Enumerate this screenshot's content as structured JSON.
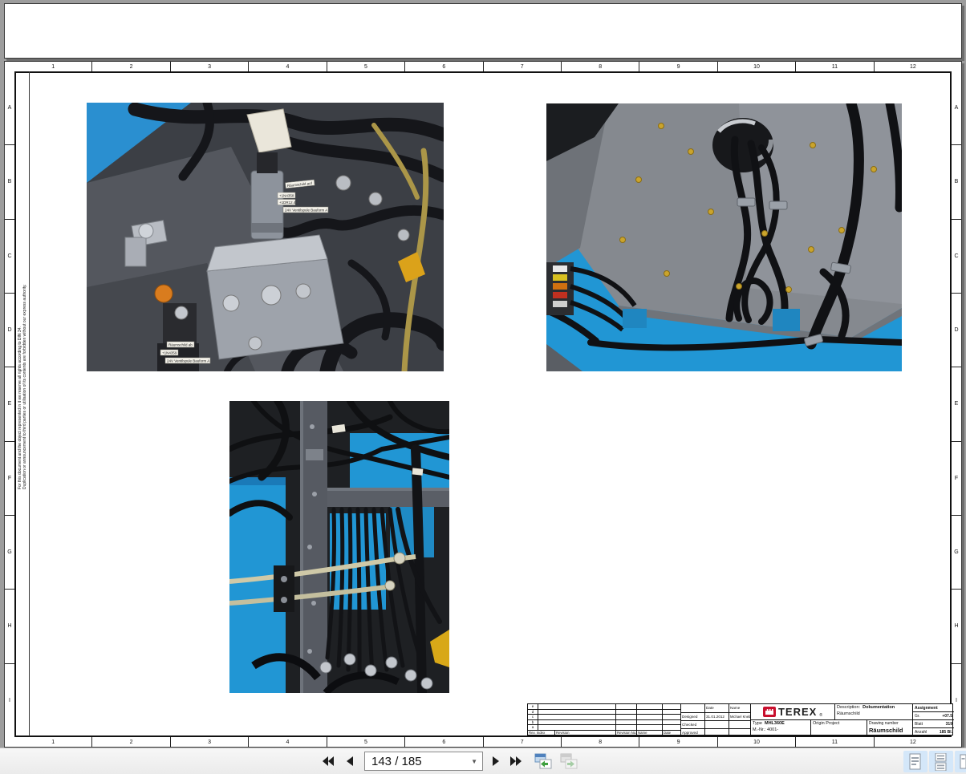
{
  "viewer": {
    "background_color": "#9d9d9d",
    "toolbar": {
      "page_field": "143 / 185",
      "icons": {
        "first_page": "double-left-triangle",
        "previous_page": "left-triangle",
        "next_page": "right-triangle",
        "last_page": "double-right-triangle",
        "dropdown": "▼",
        "previous_view": "window-green-arrow-left",
        "next_view": "window-green-arrow-right-disabled",
        "layout_single": "single-page-layout",
        "layout_continuous": "continuous-page-layout",
        "layout_facing": "facing-pages-layout"
      },
      "layout_highlight_color": "#d4e7f9"
    }
  },
  "sheet": {
    "rulers": {
      "columns": [
        "1",
        "2",
        "3",
        "4",
        "5",
        "6",
        "7",
        "8",
        "9",
        "10",
        "11",
        "12"
      ],
      "rows": [
        "A",
        "B",
        "C",
        "D",
        "E",
        "F",
        "G",
        "H",
        "I"
      ]
    },
    "copyright": {
      "line1": "For this document and the object represented in it we reserve all rights according to DIN 34.",
      "line2": "Duplication or announcement to third parties or utilisation of its contents are forbidden without our express authority."
    },
    "photos": {
      "valve_labels": [
        "Räumschild auf",
        "+1N4358",
        "+1DR12.4",
        "24V Ventilspule Bauform A",
        "Räumschild ab",
        "+1N4359",
        "24V Ventilspule Bauform A"
      ],
      "machine_blue": "#2196d4",
      "panel_gray": "#85898f"
    },
    "title_block": {
      "rev_letters": [
        "e",
        "d",
        "c",
        "b",
        "a"
      ],
      "rev_index_label": "Rev. Index",
      "revision_label": "Revision",
      "revision_no_label": "Revision No.",
      "name_label": "Name",
      "date_label": "Date",
      "designed_label": "Designed",
      "checked_label": "Checked",
      "approved_label": "Approved",
      "designed_date": "31.01.2012",
      "designed_name": "Michael Knebel",
      "brand": "TEREX",
      "brand_reg": "®",
      "brand_red": "#c8102e",
      "description_label": "Description:",
      "description_value": "Dokumentation",
      "description_value2": "Räumschild",
      "type_label": "Type",
      "type_value": "MHL360E",
      "mnr_line": "M.-Nr.: 4001-",
      "origin_label": "Origin Project",
      "drawing_number_label": "Drawing number",
      "drawing_number_value": "Räumschild",
      "assignment_label": "Assignment",
      "gr_label": "Gr.",
      "gr_value": "+07.5",
      "sheet_label": "Blatt",
      "sheet_value": "319",
      "count_label": "Anzahl",
      "count_value": "185 Bl."
    }
  }
}
